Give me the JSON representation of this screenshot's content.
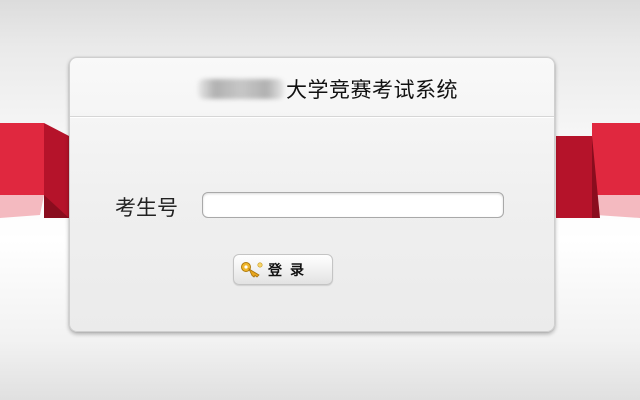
{
  "page": {
    "title_suffix": "大学竞赛考试系统"
  },
  "form": {
    "label": "考生号",
    "input_value": "",
    "input_placeholder": ""
  },
  "login_button": {
    "label": "登录",
    "icon": "key-icon"
  },
  "colors": {
    "ribbon": "#d6203a",
    "ribbon_dark": "#a50f22",
    "card_bg": "#f0f0f0"
  }
}
